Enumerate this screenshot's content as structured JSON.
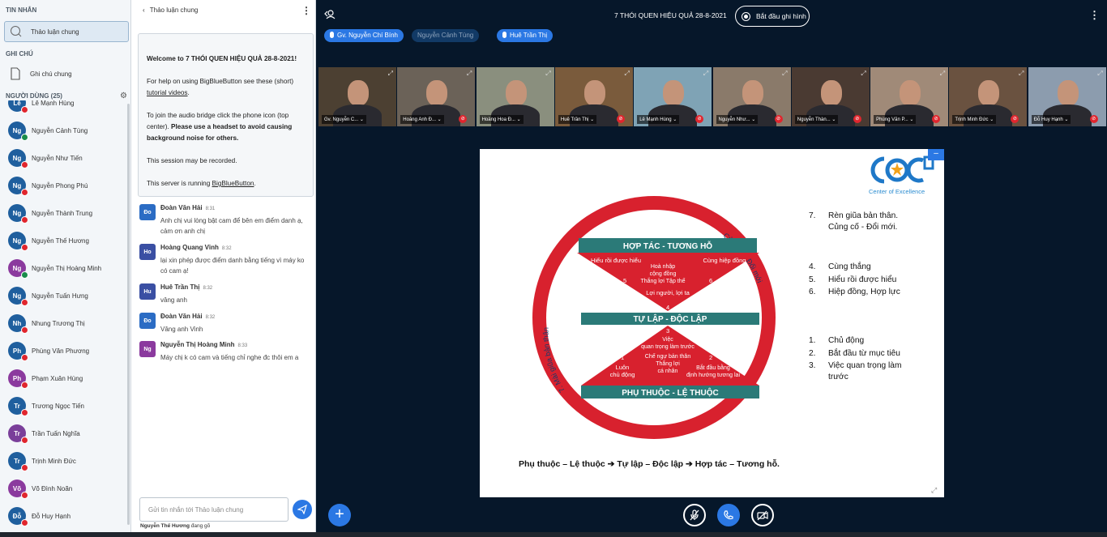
{
  "userlist": {
    "messages_title": "TIN NHẮN",
    "public_chat": "Thảo luận chung",
    "notes_title": "GHI CHÚ",
    "shared_notes": "Ghi chú chung",
    "users_title": "NGƯỜI DÙNG (25)",
    "users": [
      {
        "initials": "Lê",
        "name": "Lê Mạnh Hùng",
        "color": "#1f5f9e"
      },
      {
        "initials": "Ng",
        "name": "Nguyễn Cảnh Tùng",
        "color": "#1f5f9e"
      },
      {
        "initials": "Ng",
        "name": "Nguyễn Như Tiến",
        "color": "#1f5f9e"
      },
      {
        "initials": "Ng",
        "name": "Nguyễn Phong Phú",
        "color": "#1f5f9e"
      },
      {
        "initials": "Ng",
        "name": "Nguyễn Thành Trung",
        "color": "#1f5f9e"
      },
      {
        "initials": "Ng",
        "name": "Nguyễn Thế Hương",
        "color": "#1f5f9e"
      },
      {
        "initials": "Ng",
        "name": "Nguyễn Thị Hoàng Minh",
        "color": "#8b3a9e"
      },
      {
        "initials": "Ng",
        "name": "Nguyễn Tuấn Hưng",
        "color": "#1f5f9e"
      },
      {
        "initials": "Nh",
        "name": "Nhung Trương Thị",
        "color": "#1f5f9e"
      },
      {
        "initials": "Ph",
        "name": "Phùng Văn Phương",
        "color": "#1f5f9e"
      },
      {
        "initials": "Ph",
        "name": "Phạm Xuân Hùng",
        "color": "#8b3a9e"
      },
      {
        "initials": "Tr",
        "name": "Trương Ngọc Tiến",
        "color": "#1f5f9e"
      },
      {
        "initials": "Tr",
        "name": "Trần Tuấn Nghĩa",
        "color": "#7a3f9a"
      },
      {
        "initials": "Tr",
        "name": "Trịnh Minh Đức",
        "color": "#1f5f9e"
      },
      {
        "initials": "Võ",
        "name": "Võ Đình Noãn",
        "color": "#8b3a9e"
      },
      {
        "initials": "Đỗ",
        "name": "Đỗ Huy Hạnh",
        "color": "#1f5f9e"
      }
    ]
  },
  "chat": {
    "header": "Thảo luận chung",
    "welcome": {
      "line1a": "Welcome to ",
      "line1b": "7 THÓI QUEN HIỆU QUẢ 28-8-2021",
      "line1c": "!",
      "line2a": "For help on using BigBlueButton see these (short) ",
      "line2b": "tutorial videos",
      "line2c": ".",
      "line3a": "To join the audio bridge click the phone icon (top center). ",
      "line3b": "Please use a headset to avoid causing background noise for others.",
      "line4": "This session may be recorded.",
      "line5a": "This server is running ",
      "line5b": "BigBlueButton",
      "line5c": "."
    },
    "messages": [
      {
        "initials": "Đo",
        "name": "Đoàn Văn Hải",
        "time": "8:31",
        "text": "Anh chị vui lòng bật cam để bên em điểm danh ạ, cảm ơn anh chị",
        "color": "#2b6cc4"
      },
      {
        "initials": "Ho",
        "name": "Hoàng Quang Vinh",
        "time": "8:32",
        "text": "lại xin phép được điểm danh bằng tiếng vì máy ko có cam ạ!",
        "color": "#3a4fa3"
      },
      {
        "initials": "Hu",
        "name": "Huê Trần Thị",
        "time": "8:32",
        "text": "vâng anh",
        "color": "#3a4fa3"
      },
      {
        "initials": "Đo",
        "name": "Đoàn Văn Hải",
        "time": "8:32",
        "text": "Vâng anh Vinh",
        "color": "#2b6cc4"
      },
      {
        "initials": "Ng",
        "name": "Nguyễn Thị Hoàng Minh",
        "time": "8:33",
        "text": "Máy chị k có cam và tiếng chỉ nghe đc thôi em a",
        "color": "#8b3a9e"
      }
    ],
    "input_placeholder": "Gửi tin nhắn tới Thảo luận chung",
    "typing_name": "Nguyễn Thế Hương",
    "typing_suffix": " đang gõ"
  },
  "main": {
    "title": "7 THÓI QUEN HIỆU QUẢ 28-8-2021",
    "record_label": "Bắt đầu ghi hình",
    "talkers": [
      {
        "name": "Gv. Nguyễn Chí Bính",
        "muted": false
      },
      {
        "name": "Nguyễn Cảnh Tùng",
        "muted": true
      },
      {
        "name": "Huê Trần Thị",
        "muted": false
      }
    ],
    "videos": [
      {
        "name": "Gv. Nguyễn C...",
        "active": true,
        "bg": "#4c4032",
        "muted": false
      },
      {
        "name": "Hoàng Anh Đ...",
        "active": false,
        "bg": "#6b6258",
        "muted": true
      },
      {
        "name": "Hoàng Hoa Đ...",
        "active": false,
        "bg": "#8a8f7e",
        "muted": false
      },
      {
        "name": "Huê Trần Thị",
        "active": true,
        "bg": "#7a5b3c",
        "muted": true
      },
      {
        "name": "Lê Mạnh Hùng",
        "active": false,
        "bg": "#7fa3b5",
        "muted": true
      },
      {
        "name": "Nguyễn Như...",
        "active": false,
        "bg": "#8a7a6a",
        "muted": true
      },
      {
        "name": "Nguyễn Thàn...",
        "active": false,
        "bg": "#4a3a32",
        "muted": true
      },
      {
        "name": "Phùng Văn P...",
        "active": false,
        "bg": "#a08a78",
        "muted": true
      },
      {
        "name": "Trịnh Minh Đức",
        "active": false,
        "bg": "#6a5240",
        "muted": true
      },
      {
        "name": "Đỗ Huy Hạnh",
        "active": false,
        "bg": "#8c9cae",
        "muted": true
      }
    ]
  },
  "slide": {
    "logo_text": "Center of Excellence",
    "circle": {
      "top_band": "HỢP TÁC - TƯƠNG HỖ",
      "middle_band": "TỰ LẬP - ĐỘC LẬP",
      "bottom_band": "PHỤ THUỘC - LỆ THUỘC",
      "left_arc": "7. Mài giũa bản thân",
      "right_arc": "Củng cố - Đổi mới",
      "upper_left": "Hiểu rồi được hiểu",
      "upper_center_1": "Hoà nhập",
      "upper_center_2": "cộng đồng",
      "upper_center_3": "Thắng lợi Tập thể",
      "upper_right": "Cùng hiệp đồng",
      "upper_bottom": "Lợi người, lợi ta",
      "n5": "5",
      "n6": "6",
      "n4": "4",
      "n3": "3",
      "n1": "1",
      "n2": "2",
      "lower_top_1": "Việc",
      "lower_top_2": "quan trọng làm trước",
      "lower_center_1": "Chế ngự bản thân",
      "lower_center_2": "Thắng lợi",
      "lower_center_3": "cá nhân",
      "lower_left_1": "Luôn",
      "lower_left_2": "chủ động",
      "lower_right_1": "Bắt đầu bằng",
      "lower_right_2": "định hướng tương lai"
    },
    "list_7": [
      {
        "n": "7.",
        "t": "Rèn giũa bản thân. Củng cố - Đổi mới."
      }
    ],
    "list_456": [
      {
        "n": "4.",
        "t": "Cùng thắng"
      },
      {
        "n": "5.",
        "t": "Hiểu rồi được hiểu"
      },
      {
        "n": "6.",
        "t": "Hiệp đồng, Hợp lực"
      }
    ],
    "list_123": [
      {
        "n": "1.",
        "t": "Chủ động"
      },
      {
        "n": "2.",
        "t": "Bắt đầu từ mục tiêu"
      },
      {
        "n": "3.",
        "t": "Việc quan trọng làm trước"
      }
    ],
    "footer": "Phụ thuộc – Lệ thuộc ➔ Tự lập – Độc lập ➔ Hợp tác – Tương hỗ."
  }
}
